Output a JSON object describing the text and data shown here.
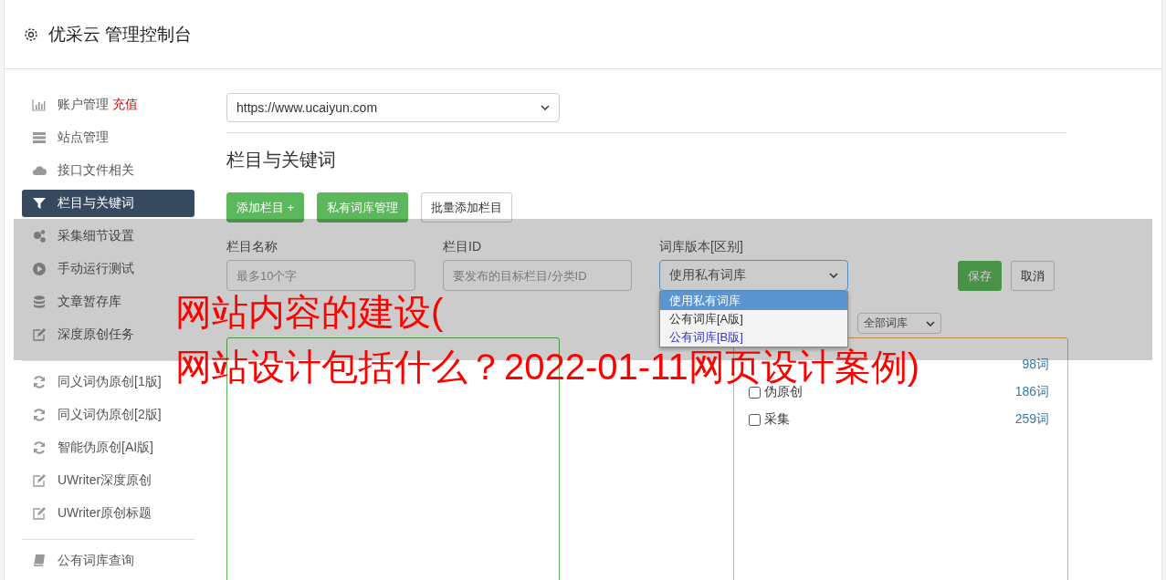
{
  "header": {
    "title": "优采云 管理控制台"
  },
  "sidebar": {
    "groups": [
      {
        "items": [
          {
            "kind": "chart",
            "label": "账户管理",
            "badge": "充值",
            "selected": false
          },
          {
            "kind": "server",
            "label": "站点管理",
            "selected": false
          },
          {
            "kind": "cloud",
            "label": "接口文件相关",
            "selected": false
          },
          {
            "kind": "filter",
            "label": "栏目与关键词",
            "selected": true
          },
          {
            "kind": "gears",
            "label": "采集细节设置",
            "selected": false
          },
          {
            "kind": "play",
            "label": "手动运行测试",
            "selected": false
          },
          {
            "kind": "database",
            "label": "文章暂存库",
            "selected": false
          },
          {
            "kind": "edit",
            "label": "深度原创任务",
            "selected": false
          }
        ]
      },
      {
        "items": [
          {
            "kind": "refresh",
            "label": "同义词伪原创[1版]",
            "selected": false
          },
          {
            "kind": "refresh",
            "label": "同义词伪原创[2版]",
            "selected": false
          },
          {
            "kind": "refresh",
            "label": "智能伪原创[AI版]",
            "selected": false
          },
          {
            "kind": "edit",
            "label": "UWriter深度原创",
            "selected": false
          },
          {
            "kind": "edit",
            "label": "UWriter原创标题",
            "selected": false
          }
        ]
      },
      {
        "items": [
          {
            "kind": "book",
            "label": "公有词库查询",
            "selected": false
          }
        ]
      }
    ]
  },
  "site_select": {
    "value": "https://www.ucaiyun.com"
  },
  "heading": "栏目与关键词",
  "buttons": [
    {
      "kind": "green",
      "label": "添加栏目 +"
    },
    {
      "kind": "green",
      "label": "私有词库管理"
    },
    {
      "kind": "outline",
      "label": "批量添加栏目"
    }
  ],
  "form": {
    "fields": [
      {
        "label": "栏目名称",
        "placeholder": "最多10个字"
      },
      {
        "label": "栏目ID",
        "placeholder": "要发布的目标栏目/分类ID"
      }
    ],
    "library": {
      "label": "词库版本[区别]",
      "value": "使用私有词库",
      "options": [
        {
          "label": "使用私有词库",
          "selected": true
        },
        {
          "label": "公有词库[A版]",
          "selected": false,
          "color": "#333333"
        },
        {
          "label": "公有词库[B版]",
          "selected": false,
          "color": "#3333cc"
        }
      ]
    },
    "save": "保存",
    "cancel": "取消"
  },
  "filter_select": {
    "value": "全部词库"
  },
  "libraries": [
    {
      "count": "98词"
    },
    {
      "label": "伪原创",
      "checked": false,
      "count": "186词"
    },
    {
      "label": "采集",
      "checked": false,
      "count": "259词"
    }
  ],
  "headline": [
    "网站内容的建设(",
    "网站设计包括什么？2022-01-11网页设计案例)"
  ]
}
